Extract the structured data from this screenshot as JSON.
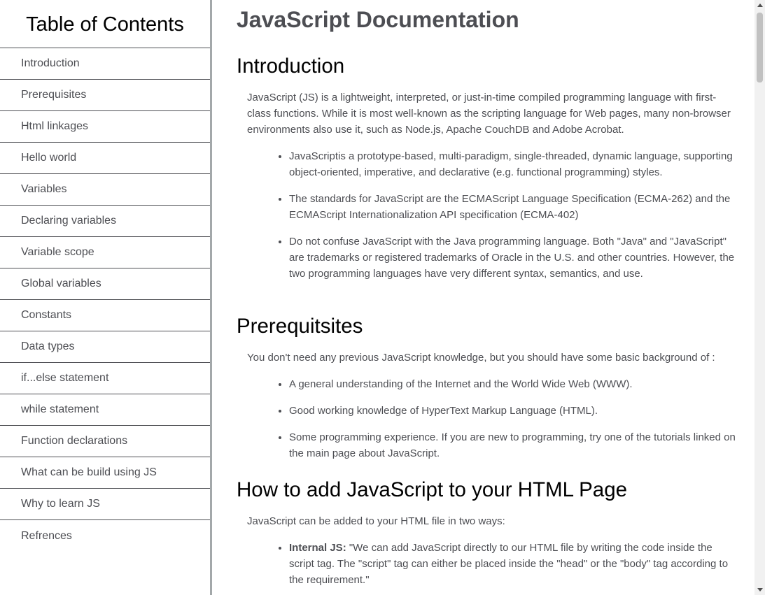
{
  "navbar": {
    "title": "Table of Contents",
    "items": [
      {
        "label": "Introduction"
      },
      {
        "label": "Prerequisites"
      },
      {
        "label": "Html linkages"
      },
      {
        "label": "Hello world"
      },
      {
        "label": "Variables"
      },
      {
        "label": "Declaring variables"
      },
      {
        "label": "Variable scope"
      },
      {
        "label": "Global variables"
      },
      {
        "label": "Constants"
      },
      {
        "label": "Data types"
      },
      {
        "label": "if...else statement"
      },
      {
        "label": "while statement"
      },
      {
        "label": "Function declarations"
      },
      {
        "label": "What can be build using JS"
      },
      {
        "label": "Why to learn JS"
      },
      {
        "label": "Refrences"
      }
    ]
  },
  "main": {
    "title": "JavaScript Documentation",
    "sections": [
      {
        "heading": "Introduction",
        "paragraph": "JavaScript (JS) is a lightweight, interpreted, or just-in-time compiled programming language with first-class functions. While it is most well-known as the scripting language for Web pages, many non-browser environments also use it, such as Node.js, Apache CouchDB and Adobe Acrobat.",
        "bullets": [
          "JavaScriptis a prototype-based, multi-paradigm, single-threaded, dynamic language, supporting object-oriented, imperative, and declarative (e.g. functional programming) styles.",
          "The standards for JavaScript are the ECMAScript Language Specification (ECMA-262) and the ECMAScript Internationalization API specification (ECMA-402)",
          "Do not confuse JavaScript with the Java programming language. Both \"Java\" and \"JavaScript\" are trademarks or registered trademarks of Oracle in the U.S. and other countries. However, the two programming languages have very different syntax, semantics, and use."
        ]
      },
      {
        "heading": "Prerequitsites",
        "paragraph": "You don't need any previous JavaScript knowledge, but you should have some basic background of :",
        "bullets": [
          "A general understanding of the Internet and the World Wide Web (WWW).",
          "Good working knowledge of HyperText Markup Language (HTML).",
          "Some programming experience. If you are new to programming, try one of the tutorials linked on the main page about JavaScript."
        ]
      },
      {
        "heading": "How to add JavaScript to your HTML Page",
        "paragraph": "JavaScript can be added to your HTML file in two ways:",
        "bullets_bold": [
          {
            "term": "Internal JS:",
            "text": " \"We can add JavaScript directly to our HTML file by writing the code inside the script tag. The \"script\" tag can either be placed inside the \"head\" or the \"body\" tag according to the requirement.\""
          }
        ]
      }
    ]
  }
}
